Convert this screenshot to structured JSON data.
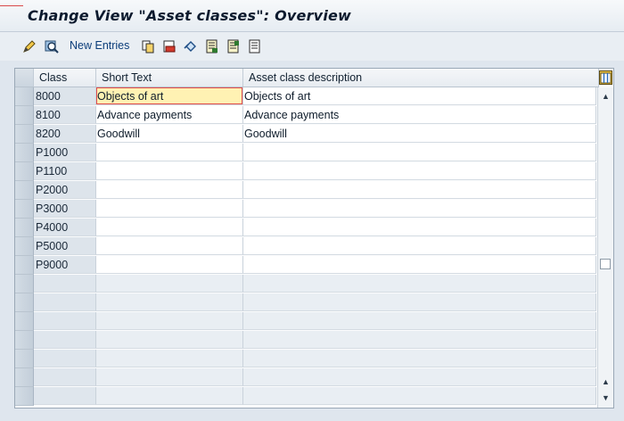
{
  "window": {
    "title": "Change View \"Asset classes\": Overview"
  },
  "toolbar": {
    "new_entries_label": "New Entries",
    "icons": [
      "edit-icon",
      "display-icon",
      "copy-icon",
      "delete-icon",
      "undo-icon",
      "select-all-icon",
      "select-block-icon",
      "deselect-all-icon"
    ]
  },
  "table": {
    "columns": [
      "Class",
      "Short Text",
      "Asset class description"
    ],
    "rows": [
      {
        "class": "8000",
        "short_text": "Objects of art",
        "description": "Objects of art"
      },
      {
        "class": "8100",
        "short_text": "Advance payments",
        "description": "Advance payments"
      },
      {
        "class": "8200",
        "short_text": "Goodwill",
        "description": "Goodwill"
      },
      {
        "class": "P1000",
        "short_text": "",
        "description": ""
      },
      {
        "class": "P1100",
        "short_text": "",
        "description": ""
      },
      {
        "class": "P2000",
        "short_text": "",
        "description": ""
      },
      {
        "class": "P3000",
        "short_text": "",
        "description": ""
      },
      {
        "class": "P4000",
        "short_text": "",
        "description": ""
      },
      {
        "class": "P5000",
        "short_text": "",
        "description": ""
      },
      {
        "class": "P9000",
        "short_text": "",
        "description": ""
      }
    ],
    "empty_row_count": 7
  },
  "colors": {
    "focus_cell": "#fff2b3",
    "focus_border": "#e04b4b",
    "link_blue": "#0b3d7a"
  }
}
